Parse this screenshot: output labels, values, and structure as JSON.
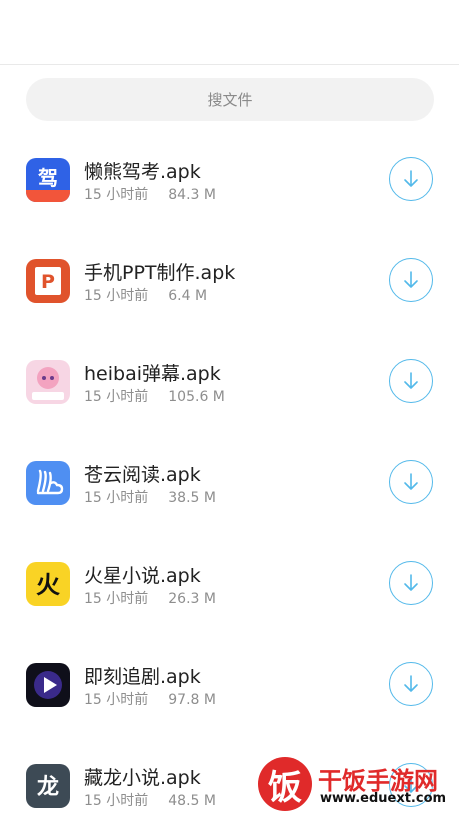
{
  "search": {
    "placeholder": "搜文件"
  },
  "colors": {
    "accent": "#53b9ea",
    "watermark": "#e02a2a"
  },
  "files": [
    {
      "name": "懒熊驾考.apk",
      "time": "15 小时前",
      "size": "84.3 M",
      "icon": "lanxiong-jiakao-icon"
    },
    {
      "name": "手机PPT制作.apk",
      "time": "15 小时前",
      "size": "6.4 M",
      "icon": "ppt-maker-icon"
    },
    {
      "name": "heibai弹幕.apk",
      "time": "15 小时前",
      "size": "105.6 M",
      "icon": "heibai-danmu-icon"
    },
    {
      "name": "苍云阅读.apk",
      "time": "15 小时前",
      "size": "38.5 M",
      "icon": "cangyun-reader-icon"
    },
    {
      "name": "火星小说.apk",
      "time": "15 小时前",
      "size": "26.3 M",
      "icon": "huoxing-novel-icon"
    },
    {
      "name": "即刻追剧.apk",
      "time": "15 小时前",
      "size": "97.8 M",
      "icon": "jike-drama-icon"
    },
    {
      "name": "藏龙小说.apk",
      "time": "15 小时前",
      "size": "48.5 M",
      "icon": "canglong-novel-icon"
    }
  ],
  "watermark": {
    "logo_char": "饭",
    "title": "干饭手游网",
    "url": "www.eduext.com"
  }
}
